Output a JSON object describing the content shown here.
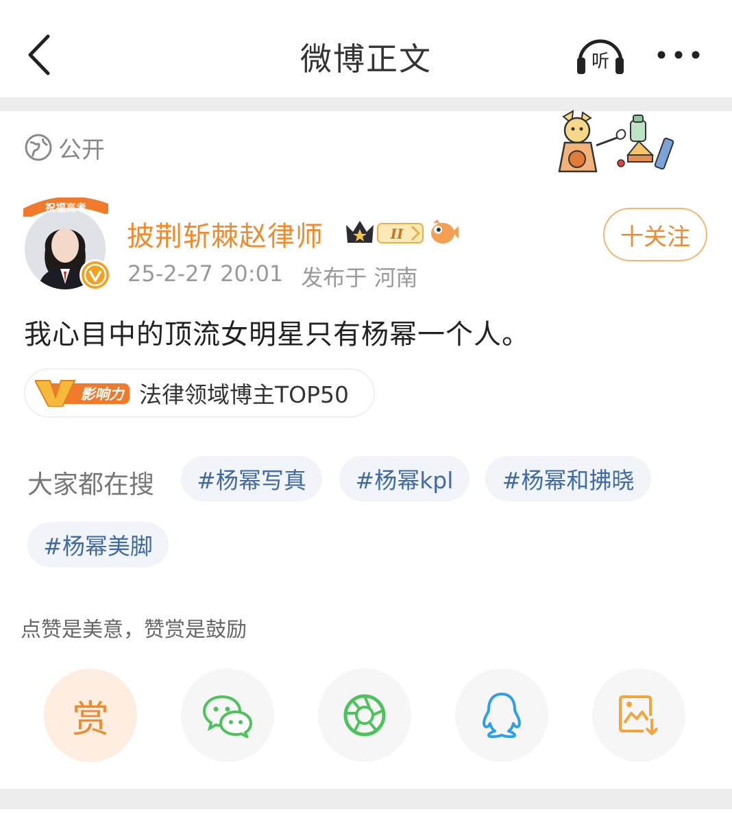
{
  "header": {
    "title": "微博正文",
    "listen_label": "听"
  },
  "post": {
    "visibility": "公开",
    "author": {
      "name": "披荆斩棘赵律师",
      "banner_text": "祝福高考",
      "level": "II"
    },
    "time": "25-2-27 20:01",
    "location": "发布于 河南",
    "follow_label": "十关注",
    "content": "我心目中的顶流女明星只有杨幂一个人。",
    "influence": {
      "badge_text": "影响力",
      "label": "法律领域博主TOP50"
    }
  },
  "search": {
    "label": "大家都在搜",
    "chips": [
      "#杨幂写真",
      "#杨幂kpl",
      "#杨幂和拂晓",
      "#杨幂美脚"
    ]
  },
  "share": {
    "hint": "点赞是美意，赞赏是鼓励",
    "reward_label": "赏",
    "icons": [
      "wechat-icon",
      "moments-icon",
      "qq-icon",
      "save-image-icon"
    ]
  },
  "colors": {
    "accent": "#f08a2c",
    "tag_blue": "#3f6aa5",
    "wechat_green": "#4cc25a",
    "qq_blue": "#2c9fe6"
  }
}
